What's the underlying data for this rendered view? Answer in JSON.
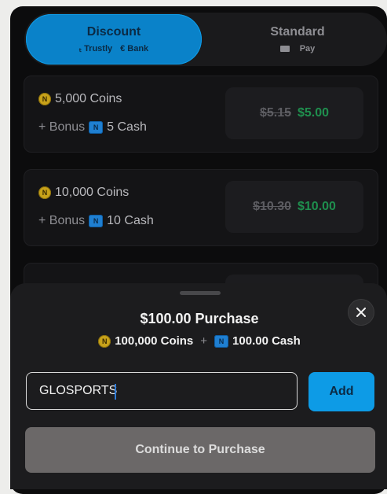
{
  "payment_toggle": {
    "discount": {
      "label": "Discount",
      "methods": [
        "Trustly",
        "Bank"
      ]
    },
    "standard": {
      "label": "Standard",
      "methods": [
        "Pay"
      ]
    }
  },
  "packages": [
    {
      "coins": "5,000 Coins",
      "bonus_prefix": "+ Bonus",
      "bonus_cash": "5 Cash",
      "old_price": "$5.15",
      "new_price": "$5.00"
    },
    {
      "coins": "10,000 Coins",
      "bonus_prefix": "+ Bonus",
      "bonus_cash": "10 Cash",
      "old_price": "$10.30",
      "new_price": "$10.00"
    }
  ],
  "sheet": {
    "title": "$100.00 Purchase",
    "coins": "100,000 Coins",
    "plus": "+",
    "cash": "100.00 Cash",
    "promo_value": "GLOSPORTS",
    "add_label": "Add",
    "continue_label": "Continue to Purchase"
  },
  "colors": {
    "accent": "#0d9be6",
    "price_green": "#1f8f4e"
  },
  "icons": {
    "coin": "coin-icon",
    "cash": "cash-icon",
    "close": "close-icon"
  }
}
